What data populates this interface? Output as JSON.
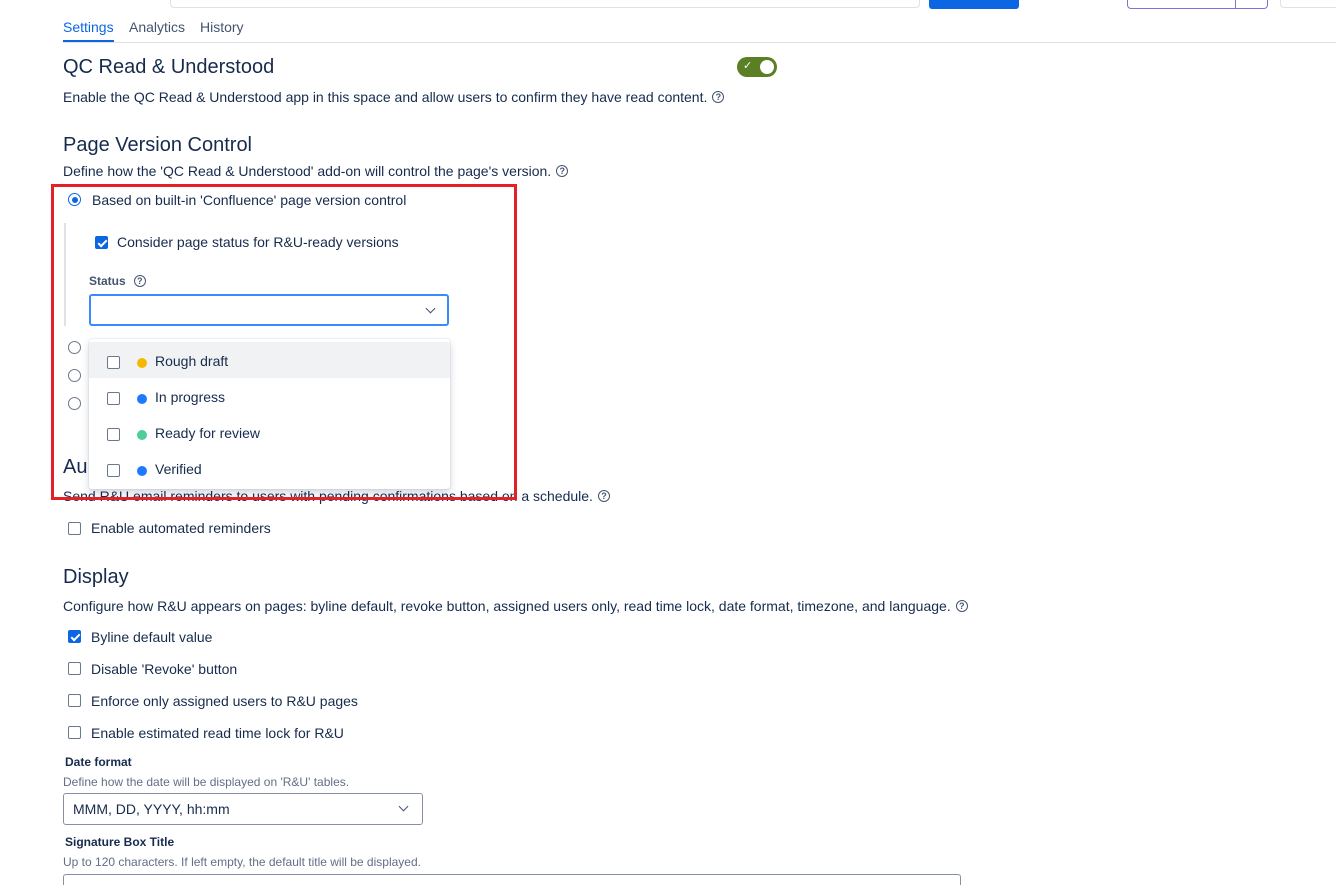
{
  "tabs": [
    {
      "label": "Settings"
    },
    {
      "label": "Analytics"
    },
    {
      "label": "History"
    }
  ],
  "qc": {
    "title": "QC Read & Understood",
    "description": "Enable the QC Read & Understood app in this space and allow users to confirm they have read content.",
    "enabled": true
  },
  "version_control": {
    "title": "Page Version Control",
    "description": "Define how the 'QC Read & Understood' add-on will control the page's version.",
    "option_builtin": "Based on built-in 'Confluence' page version control",
    "consider_status": "Consider page status for R&U-ready versions",
    "status_label": "Status",
    "status_options": [
      {
        "label": "Rough draft",
        "color": "#f5b800"
      },
      {
        "label": "In progress",
        "color": "#1d7afc"
      },
      {
        "label": "Ready for review",
        "color": "#4bce97"
      },
      {
        "label": "Verified",
        "color": "#1d7afc"
      }
    ]
  },
  "reminders": {
    "title_partial": "Au",
    "description": "Send R&U email reminders to users with pending confirmations based on a schedule.",
    "enable_label": "Enable automated reminders"
  },
  "display": {
    "title": "Display",
    "description": "Configure how R&U appears on pages: byline default, revoke button, assigned users only, read time lock, date format, timezone, and language.",
    "byline": "Byline default value",
    "disable_revoke": "Disable 'Revoke' button",
    "enforce_assigned": "Enforce only assigned users to R&U pages",
    "read_time_lock": "Enable estimated read time lock for R&U",
    "date_format_label": "Date format",
    "date_format_hint": "Define how the date will be displayed on 'R&U' tables.",
    "date_format_value": "MMM, DD, YYYY, hh:mm",
    "signature_label": "Signature Box Title",
    "signature_hint": "Up to 120 characters. If left empty, the default title will be displayed."
  },
  "colors": {
    "accent": "#0c66e4",
    "toggle_on": "#5b7f24",
    "highlight": "#e32227"
  }
}
